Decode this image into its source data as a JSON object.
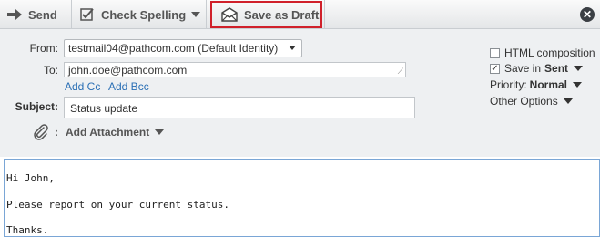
{
  "toolbar": {
    "send_label": "Send",
    "spell_label": "Check Spelling",
    "draft_label": "Save as Draft",
    "close_icon": "close-icon"
  },
  "form": {
    "from_label": "From:",
    "from_value": "testmail04@pathcom.com (Default Identity)",
    "to_label": "To:",
    "to_value": "john.doe@pathcom.com",
    "add_cc": "Add Cc",
    "add_bcc": "Add Bcc",
    "subject_label": "Subject:",
    "subject_value": "Status update",
    "attach_separator": ":",
    "add_attachment": "Add Attachment"
  },
  "options": {
    "html_composition": "HTML composition",
    "html_checked": false,
    "save_in_prefix": "Save in",
    "save_in_folder": "Sent",
    "save_checked": true,
    "priority_label": "Priority:",
    "priority_value": "Normal",
    "other_options": "Other Options"
  },
  "message": {
    "line1": "Hi John,",
    "line2": "Please report on your current status.",
    "line3": "Thanks."
  },
  "colors": {
    "highlight": "#d0202a",
    "link": "#2a6fb5"
  }
}
